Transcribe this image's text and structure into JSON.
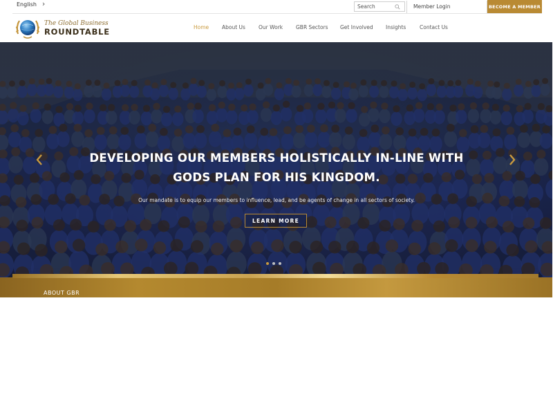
{
  "topbar": {
    "language": "English",
    "search_placeholder": "Search",
    "member_login": "Member Login",
    "become_member": "BECOME A MEMBER"
  },
  "logo": {
    "script_text": "The Global Business",
    "main_text": "ROUNDTABLE"
  },
  "nav": {
    "items": [
      {
        "label": "Home",
        "active": true
      },
      {
        "label": "About Us",
        "active": false
      },
      {
        "label": "Our Work",
        "active": false
      },
      {
        "label": "GBR Sectors",
        "active": false
      },
      {
        "label": "Get Involved",
        "active": false
      },
      {
        "label": "Insights",
        "active": false
      },
      {
        "label": "Contact Us",
        "active": false
      }
    ]
  },
  "hero": {
    "title_line1": "DEVELOPING OUR MEMBERS HOLISTICALLY IN-LINE WITH",
    "title_line2": "GODS PLAN FOR HIS KINGDOM.",
    "subtitle": "Our mandate is to equip our members to influence, lead, and be agents of change in all sectors of society.",
    "button_label": "LEARN MORE",
    "slide_count": 3,
    "active_slide": 1
  },
  "about": {
    "label": "ABOUT GBR"
  },
  "colors": {
    "gold": "#b98a33",
    "nav_active": "#c99a3e",
    "hero_blue": "#2f3f6e"
  },
  "icons": [
    "chevron-right-icon",
    "search-icon",
    "globe-laurel-logo",
    "chevron-left-icon"
  ]
}
